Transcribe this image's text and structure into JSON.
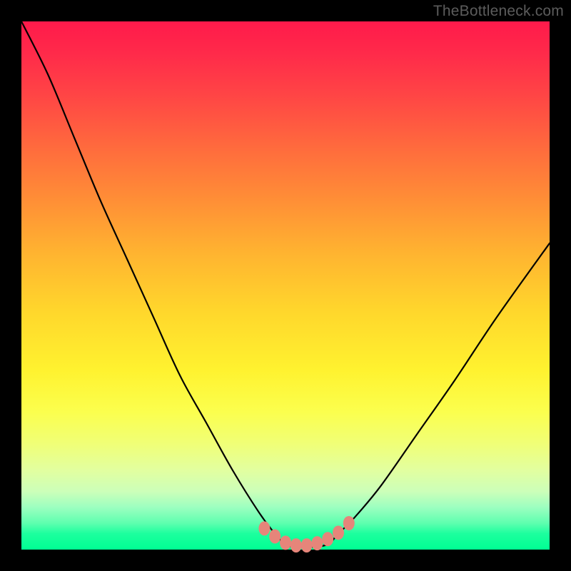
{
  "watermark": "TheBottleneck.com",
  "chart_data": {
    "type": "line",
    "title": "",
    "xlabel": "",
    "ylabel": "",
    "xlim": [
      0,
      100
    ],
    "ylim": [
      0,
      100
    ],
    "grid": false,
    "legend": false,
    "series": [
      {
        "name": "bottleneck-curve",
        "x": [
          0,
          5,
          10,
          15,
          20,
          25,
          30,
          35,
          40,
          45,
          48,
          50,
          52,
          55,
          58,
          60,
          63,
          68,
          75,
          82,
          90,
          100
        ],
        "values": [
          100,
          90,
          78,
          66,
          55,
          44,
          33,
          24,
          15,
          7,
          3,
          1,
          0.5,
          0.5,
          1,
          3,
          6,
          12,
          22,
          32,
          44,
          58
        ]
      }
    ],
    "markers": {
      "name": "bottom-dots",
      "color": "#e6857a",
      "x": [
        46,
        48,
        50,
        52,
        54,
        56,
        58,
        60,
        62
      ],
      "y": [
        4.0,
        2.5,
        1.3,
        0.8,
        0.8,
        1.2,
        2.0,
        3.2,
        5.0
      ]
    },
    "background_gradient": {
      "top": "#ff1a4b",
      "mid": "#ffd72c",
      "bottom": "#00ff93"
    }
  }
}
